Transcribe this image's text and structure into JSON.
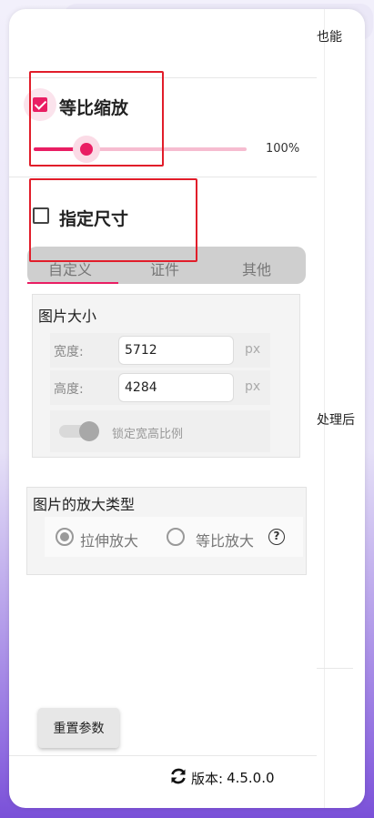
{
  "side_panel": {
    "top_text": "也能",
    "mid_text": "处理后"
  },
  "options": {
    "proportional": {
      "label": "等比缩放",
      "checked": true
    },
    "scale": {
      "value": 100,
      "value_text": "100%"
    },
    "fixed_size": {
      "label": "指定尺寸",
      "checked": false
    }
  },
  "tabs": [
    {
      "label": "自定义",
      "active": true
    },
    {
      "label": "证件",
      "active": false
    },
    {
      "label": "其他",
      "active": false
    }
  ],
  "image_size": {
    "title": "图片大小",
    "width_label": "宽度:",
    "width_value": "5712",
    "height_label": "高度:",
    "height_value": "4284",
    "unit": "px",
    "lock_label": "锁定宽高比例",
    "lock_on": true
  },
  "enlarge_type": {
    "title": "图片的放大类型",
    "options": [
      {
        "label": "拉伸放大",
        "selected": true
      },
      {
        "label": "等比放大",
        "selected": false
      }
    ],
    "help_icon": "question-circle-icon"
  },
  "footer": {
    "reset_label": "重置参数",
    "version_prefix": "版本:",
    "version": "4.5.0.0",
    "version_icon": "refresh-icon"
  },
  "colors": {
    "accent": "#e91e63",
    "highlight_box": "#e11d2a",
    "background_gradient_end": "#7a50d8"
  }
}
